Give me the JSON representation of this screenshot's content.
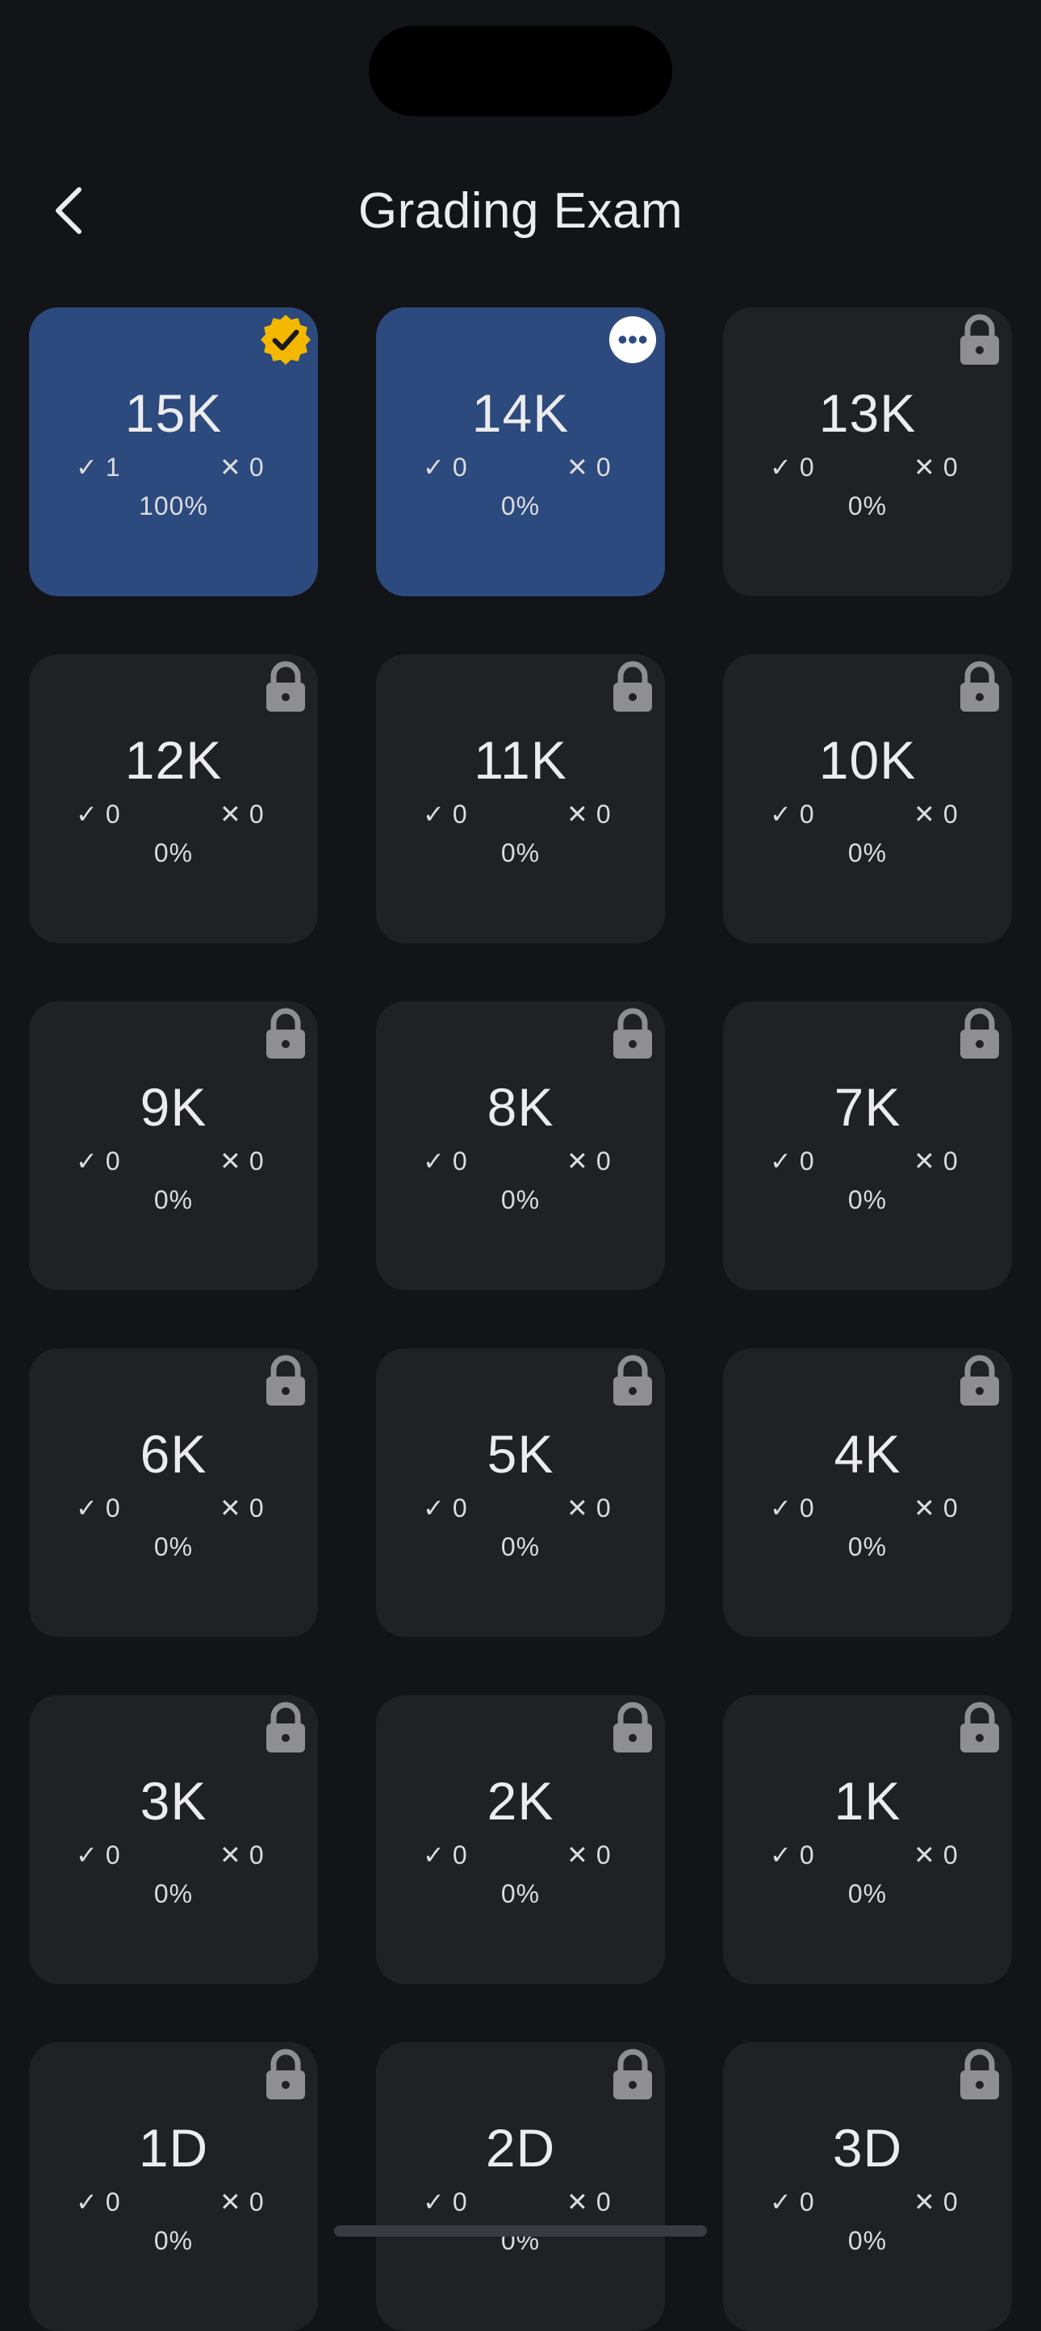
{
  "header": {
    "title": "Grading Exam",
    "back_icon": "chevron-left-icon"
  },
  "colors": {
    "background": "#131418",
    "card": "#202125",
    "card_active": "#2d4a7e",
    "badge_gold": "#f5b800",
    "lock_gray": "#8e8e93"
  },
  "levels": [
    {
      "id": "15k",
      "label": "15K",
      "correct": "1",
      "wrong": "0",
      "percent": "100%",
      "state": "passed",
      "badge_icon": "verified-badge-icon"
    },
    {
      "id": "14k",
      "label": "14K",
      "correct": "0",
      "wrong": "0",
      "percent": "0%",
      "state": "current",
      "badge_icon": "more-icon"
    },
    {
      "id": "13k",
      "label": "13K",
      "correct": "0",
      "wrong": "0",
      "percent": "0%",
      "state": "locked",
      "badge_icon": "lock-icon"
    },
    {
      "id": "12k",
      "label": "12K",
      "correct": "0",
      "wrong": "0",
      "percent": "0%",
      "state": "locked",
      "badge_icon": "lock-icon"
    },
    {
      "id": "11k",
      "label": "11K",
      "correct": "0",
      "wrong": "0",
      "percent": "0%",
      "state": "locked",
      "badge_icon": "lock-icon"
    },
    {
      "id": "10k",
      "label": "10K",
      "correct": "0",
      "wrong": "0",
      "percent": "0%",
      "state": "locked",
      "badge_icon": "lock-icon"
    },
    {
      "id": "9k",
      "label": "9K",
      "correct": "0",
      "wrong": "0",
      "percent": "0%",
      "state": "locked",
      "badge_icon": "lock-icon"
    },
    {
      "id": "8k",
      "label": "8K",
      "correct": "0",
      "wrong": "0",
      "percent": "0%",
      "state": "locked",
      "badge_icon": "lock-icon"
    },
    {
      "id": "7k",
      "label": "7K",
      "correct": "0",
      "wrong": "0",
      "percent": "0%",
      "state": "locked",
      "badge_icon": "lock-icon"
    },
    {
      "id": "6k",
      "label": "6K",
      "correct": "0",
      "wrong": "0",
      "percent": "0%",
      "state": "locked",
      "badge_icon": "lock-icon"
    },
    {
      "id": "5k",
      "label": "5K",
      "correct": "0",
      "wrong": "0",
      "percent": "0%",
      "state": "locked",
      "badge_icon": "lock-icon"
    },
    {
      "id": "4k",
      "label": "4K",
      "correct": "0",
      "wrong": "0",
      "percent": "0%",
      "state": "locked",
      "badge_icon": "lock-icon"
    },
    {
      "id": "3k",
      "label": "3K",
      "correct": "0",
      "wrong": "0",
      "percent": "0%",
      "state": "locked",
      "badge_icon": "lock-icon"
    },
    {
      "id": "2k",
      "label": "2K",
      "correct": "0",
      "wrong": "0",
      "percent": "0%",
      "state": "locked",
      "badge_icon": "lock-icon"
    },
    {
      "id": "1k",
      "label": "1K",
      "correct": "0",
      "wrong": "0",
      "percent": "0%",
      "state": "locked",
      "badge_icon": "lock-icon"
    },
    {
      "id": "1d",
      "label": "1D",
      "correct": "0",
      "wrong": "0",
      "percent": "0%",
      "state": "locked",
      "badge_icon": "lock-icon"
    },
    {
      "id": "2d",
      "label": "2D",
      "correct": "0",
      "wrong": "0",
      "percent": "0%",
      "state": "locked",
      "badge_icon": "lock-icon"
    },
    {
      "id": "3d",
      "label": "3D",
      "correct": "0",
      "wrong": "0",
      "percent": "0%",
      "state": "locked",
      "badge_icon": "lock-icon"
    }
  ],
  "symbols": {
    "correct": "✓",
    "wrong": "✕"
  }
}
